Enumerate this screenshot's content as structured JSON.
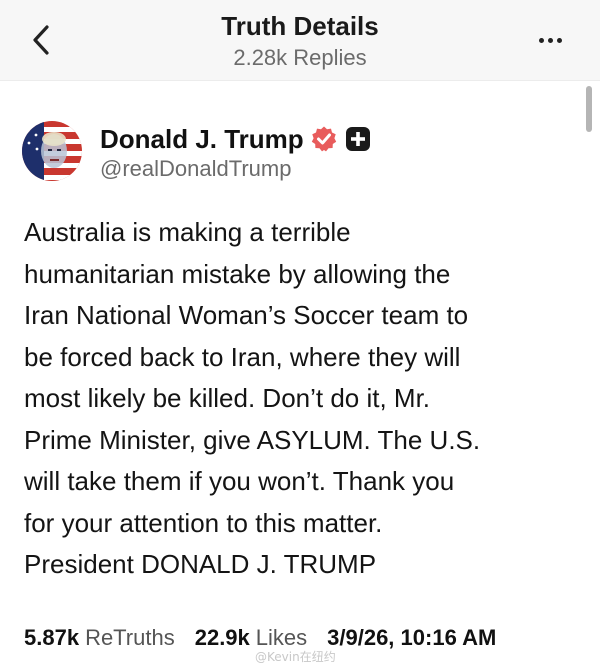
{
  "header": {
    "title": "Truth Details",
    "subtitle": "2.28k Replies",
    "back_icon": "chevron-left-icon",
    "more_icon": "more-horizontal-icon"
  },
  "post": {
    "author": {
      "display_name": "Donald J. Trump",
      "handle": "@realDonaldTrump",
      "verified_badge_color": "#e85c5c"
    },
    "lines": [
      "Australia is making a terrible",
      "humanitarian mistake by allowing the",
      "Iran National Woman’s Soccer team to",
      "be forced back to Iran, where they will",
      "most likely be killed. Don’t do it, Mr.",
      "Prime Minister, give ASYLUM. The U.S.",
      "will take them if you won’t. Thank you",
      "for your attention to this matter.",
      "President DONALD J. TRUMP"
    ],
    "stats": {
      "retruths_count": "5.87k",
      "retruths_label": "ReTruths",
      "likes_count": "22.9k",
      "likes_label": "Likes",
      "timestamp": "3/9/26, 10:16 AM"
    }
  },
  "watermark": "@Kevin在纽约"
}
